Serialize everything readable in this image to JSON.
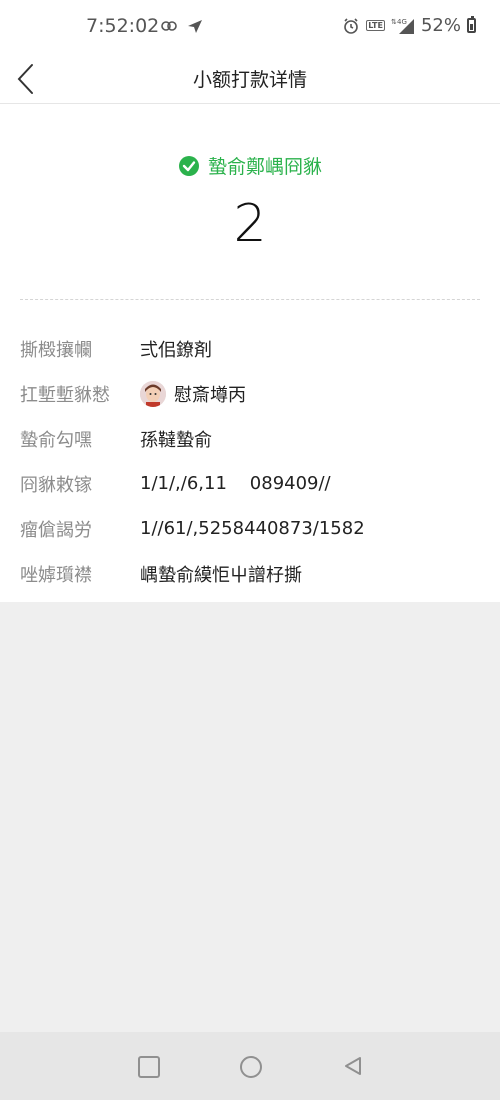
{
  "status_bar": {
    "time": "7:52:02",
    "battery": "52%",
    "network": "4G",
    "volte": "LTE"
  },
  "header": {
    "title": "小额打款详情"
  },
  "result": {
    "status": "蟄俞鄭嵎冏貅",
    "amount": "2"
  },
  "details": [
    {
      "label": "撕檓攘幱",
      "value": "弍佀鐐剤"
    },
    {
      "label": "扛塹塹貅慭",
      "value": "慰斎壿丙",
      "has_avatar": true
    },
    {
      "label": "蟄俞勾嘿",
      "value": "孫韃蟄俞"
    },
    {
      "label": "冏貅敕镓",
      "value": "1/1/,/6,11    089409//"
    },
    {
      "label": "瘤傖謁労",
      "value": "1//61/,5258440873/1582"
    },
    {
      "label": "唑嫭瓆襟",
      "value": "嵎蟄俞縸怇屮譄杍撕"
    }
  ],
  "colors": {
    "success": "#2bb24c",
    "label": "#8c8c8c",
    "background": "#efefef"
  }
}
